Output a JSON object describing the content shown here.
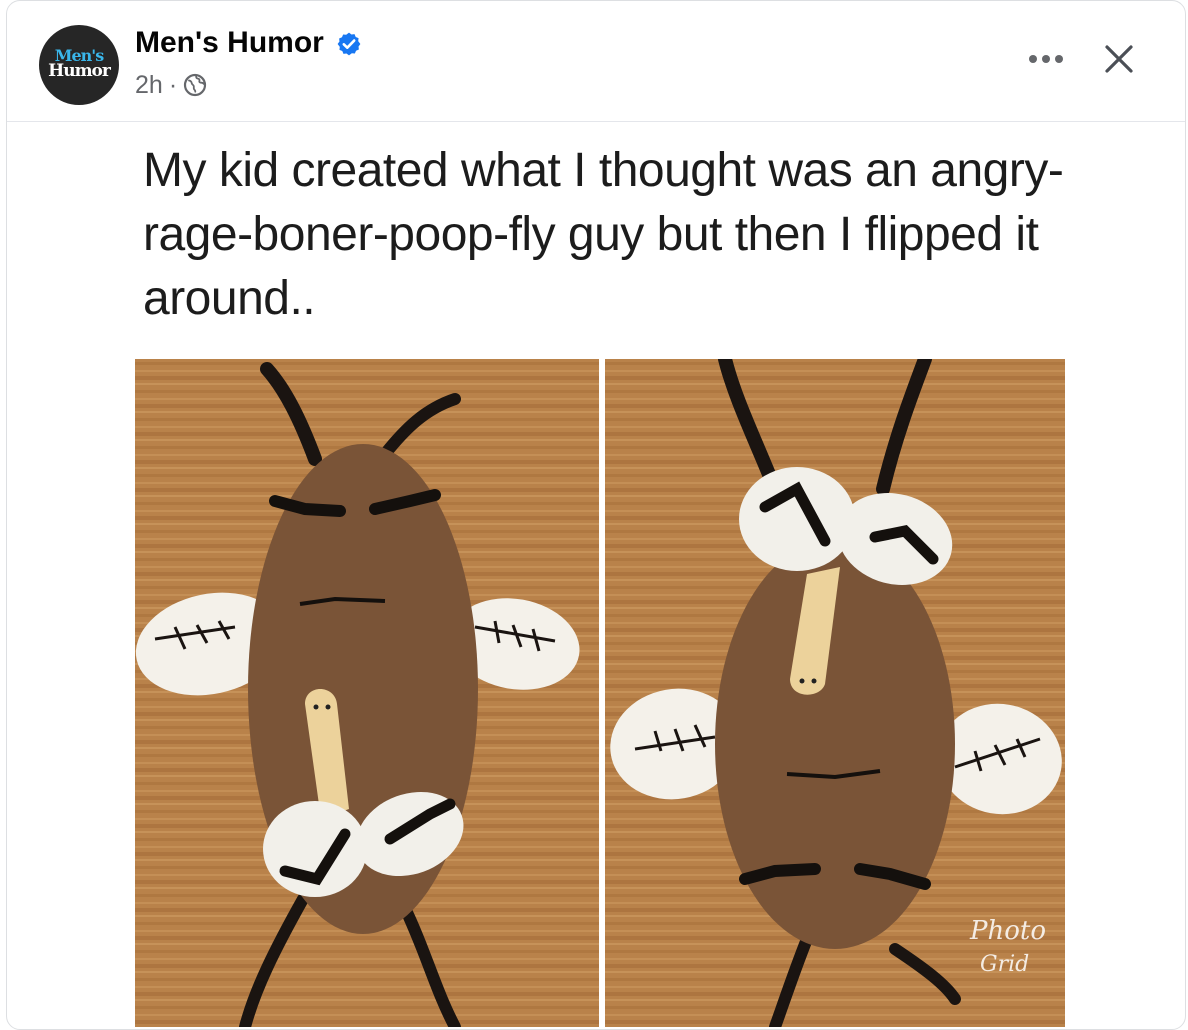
{
  "post": {
    "page_name": "Men's Humor",
    "avatar_line1": "Men's",
    "avatar_line2": "Humor",
    "time": "2h",
    "separator": "·",
    "audience_icon": "globe-icon",
    "verified_icon": "verified-badge-icon",
    "more_icon": "more-horizontal-icon",
    "close_icon": "close-icon",
    "caption": "My kid created what I thought was an angry-rage-boner-poop-fly guy but then I flipped it around..",
    "image_watermark": "Photo Grid"
  },
  "colors": {
    "verified": "#1877f2",
    "secondary_text": "#65676b",
    "wood": "#b9824a",
    "body_brown": "#7a5437"
  }
}
